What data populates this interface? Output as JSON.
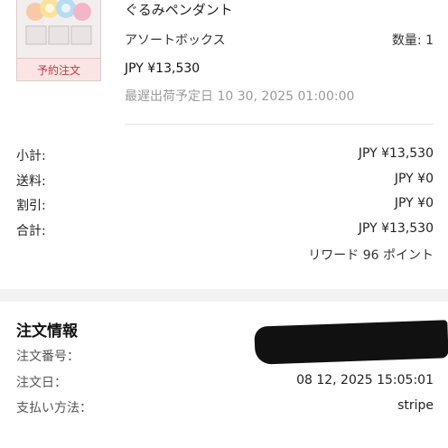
{
  "product": {
    "title": "ぐるみペンダント",
    "variant": "アソートボックス",
    "quantity": "数量: 1",
    "price": "JPY ¥13,530",
    "shipping_date": "最遅出荷予定日 10 30, 2025 01:00:00",
    "badge": "予約注文"
  },
  "summary": [
    {
      "label": "小計:",
      "value": "JPY ¥13,530"
    },
    {
      "label": "送料:",
      "value": "JPY ¥0"
    },
    {
      "label": "割引:",
      "value": "JPY ¥0"
    },
    {
      "label": "合計:",
      "value": "JPY ¥13,530"
    }
  ],
  "reward": "リワード 96 ポイント",
  "order_info": {
    "title": "注文情報",
    "rows": [
      {
        "label": "注文番号：",
        "value": ""
      },
      {
        "label": "注文日：",
        "value": "08 12, 2025 15:05:01"
      },
      {
        "label": "支払い方法：",
        "value": "stripe"
      }
    ]
  },
  "colors": {
    "badge_text": "#c23b3b",
    "muted_text": "#9a9a9a",
    "section_gap": "#f2f2f2"
  }
}
